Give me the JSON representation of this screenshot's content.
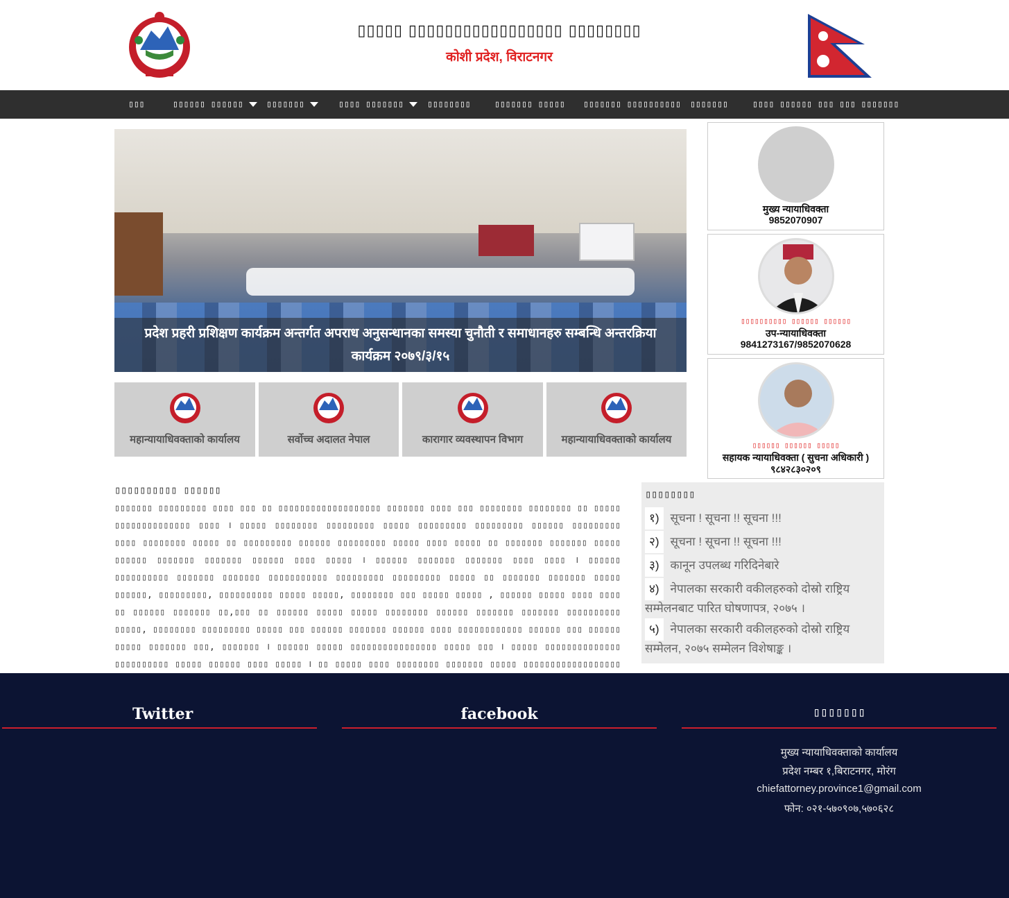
{
  "header": {
    "title": "▯▯▯▯▯ ▯▯▯▯▯▯▯▯▯▯▯▯▯▯▯▯▯ ▯▯▯▯▯▯▯▯",
    "subtitle": "कोशी प्रदेश, विराटनगर"
  },
  "nav": {
    "items": [
      {
        "label": "▯▯▯",
        "dropdown": false
      },
      {
        "label": "▯▯▯▯▯▯ ▯▯▯▯▯▯",
        "dropdown": true
      },
      {
        "label": "▯▯▯▯▯▯▯",
        "dropdown": true
      },
      {
        "label": "▯▯▯▯ ▯▯▯▯▯▯▯",
        "dropdown": true
      },
      {
        "label": "▯▯▯▯▯▯▯▯",
        "dropdown": false
      },
      {
        "label": "▯▯▯▯▯▯▯ ▯▯▯▯▯",
        "dropdown": false
      },
      {
        "label": "▯▯▯▯▯▯▯ ▯▯▯▯▯▯▯▯▯▯",
        "dropdown": false
      },
      {
        "label": "▯▯▯▯▯▯▯",
        "dropdown": false
      },
      {
        "label": "▯▯▯▯ ▯▯▯▯▯▯ ▯▯▯ ▯▯▯ ▯▯▯▯▯▯▯",
        "dropdown": false
      }
    ]
  },
  "slider": {
    "caption": "प्रदेश प्रहरी प्रशिक्षण कार्यक्रम अन्तर्गत अपराध अनुसन्धानका समस्या चुनौती र समाधानहरु सम्बन्धि अन्तरक्रिया कार्यक्रम २०७९/३/१५"
  },
  "links": [
    {
      "label": "महान्यायाधिवक्ताको कार्यालय"
    },
    {
      "label": "सर्वोच्च अदालत नेपाल"
    },
    {
      "label": "कारागार व्यवस्थापन विभाग"
    },
    {
      "label": "महान्यायाधिवक्ताको कार्यालय"
    }
  ],
  "profiles": [
    {
      "name": "",
      "title": "मुख्य न्यायाधिवक्ता",
      "phone": "9852070907"
    },
    {
      "name": "▯▯▯▯▯▯▯▯▯▯ ▯▯▯▯▯▯ ▯▯▯▯▯▯",
      "title": "उप-न्यायाधिवक्ता",
      "phone": "9841273167/9852070628"
    },
    {
      "name": "▯▯▯▯▯▯ ▯▯▯▯▯▯ ▯▯▯▯▯",
      "title": "सहायक न्यायाधिवक्ता ( सुचना अधिकारी )",
      "phone": "९८४२८३०२०९"
    }
  ],
  "intro": {
    "heading": "▯▯▯▯▯▯▯▯▯▯ ▯▯▯▯▯▯",
    "body": "▯▯▯▯▯▯▯ ▯▯▯▯▯▯▯▯▯ ▯▯▯▯ ▯▯▯ ▯▯ ▯▯▯▯▯▯▯▯▯▯▯▯▯▯▯▯▯▯▯ ▯▯▯▯▯▯▯ ▯▯▯▯ ▯▯▯ ▯▯▯▯▯▯▯▯ ▯▯▯▯▯▯▯▯ ▯▯ ▯▯▯▯▯ ▯▯▯▯▯▯▯▯▯▯▯▯▯▯ ▯▯▯▯ । ▯▯▯▯▯ ▯▯▯▯▯▯▯▯ ▯▯▯▯▯▯▯▯▯ ▯▯▯▯▯ ▯▯▯▯▯▯▯▯▯ ▯▯▯▯▯▯▯▯▯ ▯▯▯▯▯▯ ▯▯▯▯▯▯▯▯▯ ▯▯▯▯ ▯▯▯▯▯▯▯▯ ▯▯▯▯▯ ▯▯ ▯▯▯▯▯▯▯▯▯ ▯▯▯▯▯▯ ▯▯▯▯▯▯▯▯▯ ▯▯▯▯▯ ▯▯▯▯ ▯▯▯▯▯ ▯▯ ▯▯▯▯▯▯▯ ▯▯▯▯▯▯▯ ▯▯▯▯▯ ▯▯▯▯▯▯ ▯▯▯▯▯▯▯ ▯▯▯▯▯▯▯ ▯▯▯▯▯▯ ▯▯▯▯ ▯▯▯▯▯ । ▯▯▯▯▯▯ ▯▯▯▯▯▯▯ ▯▯▯▯▯▯▯ ▯▯▯▯ ▯▯▯▯ । ▯▯▯▯▯▯ ▯▯▯▯▯▯▯▯▯▯ ▯▯▯▯▯▯▯ ▯▯▯▯▯▯▯ ▯▯▯▯▯▯▯▯▯▯▯ ▯▯▯▯▯▯▯▯▯ ▯▯▯▯▯▯▯▯▯ ▯▯▯▯▯ ▯▯ ▯▯▯▯▯▯▯ ▯▯▯▯▯▯▯ ▯▯▯▯▯ ▯▯▯▯▯▯, ▯▯▯▯▯▯▯▯▯, ▯▯▯▯▯▯▯▯▯▯ ▯▯▯▯▯ ▯▯▯▯▯, ▯▯▯▯▯▯▯▯ ▯▯▯ ▯▯▯▯▯ ▯▯▯▯▯ , ▯▯▯▯▯▯ ▯▯▯▯▯ ▯▯▯▯ ▯▯▯▯ ▯▯ ▯▯▯▯▯▯ ▯▯▯▯▯▯▯ ▯▯,▯▯▯ ▯▯ ▯▯▯▯▯▯ ▯▯▯▯▯ ▯▯▯▯▯ ▯▯▯▯▯▯▯▯ ▯▯▯▯▯▯ ▯▯▯▯▯▯▯ ▯▯▯▯▯▯▯ ▯▯▯▯▯▯▯▯▯▯ ▯▯▯▯▯, ▯▯▯▯▯▯▯▯ ▯▯▯▯▯▯▯▯▯ ▯▯▯▯▯ ▯▯▯ ▯▯▯▯▯▯ ▯▯▯▯▯▯▯ ▯▯▯▯▯▯ ▯▯▯▯ ▯▯▯▯▯▯▯▯▯▯▯▯ ▯▯▯▯▯▯ ▯▯▯ ▯▯▯▯▯▯ ▯▯▯▯▯ ▯▯▯▯▯▯▯ ▯▯▯, ▯▯▯▯▯▯▯ । ▯▯▯▯▯▯ ▯▯▯▯▯ ▯▯▯▯▯▯▯▯▯▯▯▯▯▯▯▯ ▯▯▯▯▯ ▯▯▯ । ▯▯▯▯▯ ▯▯▯▯▯▯▯▯▯▯▯▯▯▯ ▯▯▯▯▯▯▯▯▯▯ ▯▯▯▯▯ ▯▯▯▯▯▯ ▯▯▯▯ ▯▯▯▯▯ । ▯▯ ▯▯▯▯▯ ▯▯▯▯ ▯▯▯▯▯▯▯▯ ▯▯▯▯▯▯▯ ▯▯▯▯▯ ▯▯▯▯▯▯▯▯▯▯▯▯▯▯▯▯▯▯ ▯▯▯▯▯▯▯▯▯▯▯ ▯▯▯▯▯▯ ▯▯▯▯▯▯ ▯▯▯▯▯▯▯▯▯▯▯ । ▯▯▯▯▯▯ ▯▯▯▯▯▯▯ ▯▯▯▯▯▯▯▯▯▯ ▯▯▯▯▯▯▯▯▯▯ ▯▯▯▯▯▯▯▯ ▯▯▯▯▯▯ ▯▯▯▯▯ । । ▯▯▯▯▯▯▯▯▯ ▯▯▯▯▯▯ ▯▯▯▯▯▯▯▯▯ ▯▯▯▯▯▯▯ ▯▯▯ ।"
  },
  "notices": {
    "heading": "▯▯▯▯▯▯▯▯",
    "items": [
      {
        "num": "१)",
        "text": "सूचना ! सूचना !! सूचना !!!"
      },
      {
        "num": "२)",
        "text": "सूचना ! सूचना !! सूचना !!!"
      },
      {
        "num": "३)",
        "text": "कानून उपलब्ध गरिदिनेबारे"
      },
      {
        "num": "४)",
        "text": "नेपालका सरकारी वकीलहरुको दोस्रो राष्ट्रिय सम्मेलनबाट पारित घोषणापत्र, २०७५ ।"
      },
      {
        "num": "५)",
        "text": "नेपालका सरकारी वकीलहरुको दोस्रो राष्ट्रिय सम्मेलन, २०७५ सम्मेलन विशेषाङ्क ।"
      }
    ]
  },
  "footer": {
    "twitter_title": "Twitter",
    "facebook_title": "facebook",
    "contact_title": "▯▯▯▯▯▯▯",
    "contact_lines": [
      "मुख्य न्यायाधिवक्ताको कार्यालय",
      "प्रदेश नम्बर १,बिराटनगर, मोरंग",
      "chiefattorney.province1@gmail.com",
      "फोन: ०२१-५७०९०७,५७०६२८"
    ]
  },
  "colors": {
    "nav_bg": "#2f2f2f",
    "accent_red": "#e02222",
    "footer_bg": "#0c1433",
    "footer_line": "#cc1f2d"
  }
}
